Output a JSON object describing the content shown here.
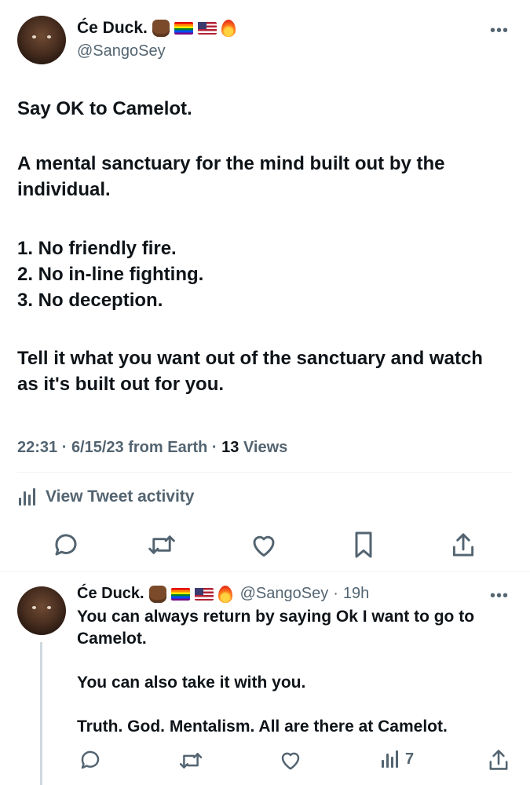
{
  "tweet": {
    "author_name": "Će Duck.",
    "author_handle": "@SangoSey",
    "more_label": "•••",
    "paragraphs": [
      "Say OK to Camelot.",
      "A mental sanctuary for the mind built out by the individual.",
      "1. No friendly fire.\n2. No in-line fighting.\n3. No deception.",
      "Tell it what you want out of the sanctuary and watch as it's built out for you."
    ],
    "time": "22:31",
    "date": "6/15/23",
    "source": "from Earth",
    "views_count": "13",
    "views_label": "Views",
    "activity_label": "View Tweet activity"
  },
  "reply": {
    "author_name": "Će Duck.",
    "author_handle": "@SangoSey",
    "age": "19h",
    "more_label": "•••",
    "lines": [
      "You can always return by saying Ok I want to go to Camelot.",
      "You can also take it with you.",
      "Truth. God. Mentalism. All are there at Camelot."
    ],
    "views_count": "7"
  },
  "colors": {
    "text": "#0f1419",
    "secondary": "#536471",
    "icon": "#536471",
    "divider": "#eff3f4",
    "thread_line": "#cfd9de"
  },
  "icons": [
    "avatar",
    "raised-fist-emoji",
    "rainbow-flag-emoji",
    "us-flag-emoji",
    "fire-emoji",
    "more-icon",
    "analytics-icon",
    "reply-icon",
    "retweet-icon",
    "like-icon",
    "bookmark-icon",
    "share-icon"
  ]
}
